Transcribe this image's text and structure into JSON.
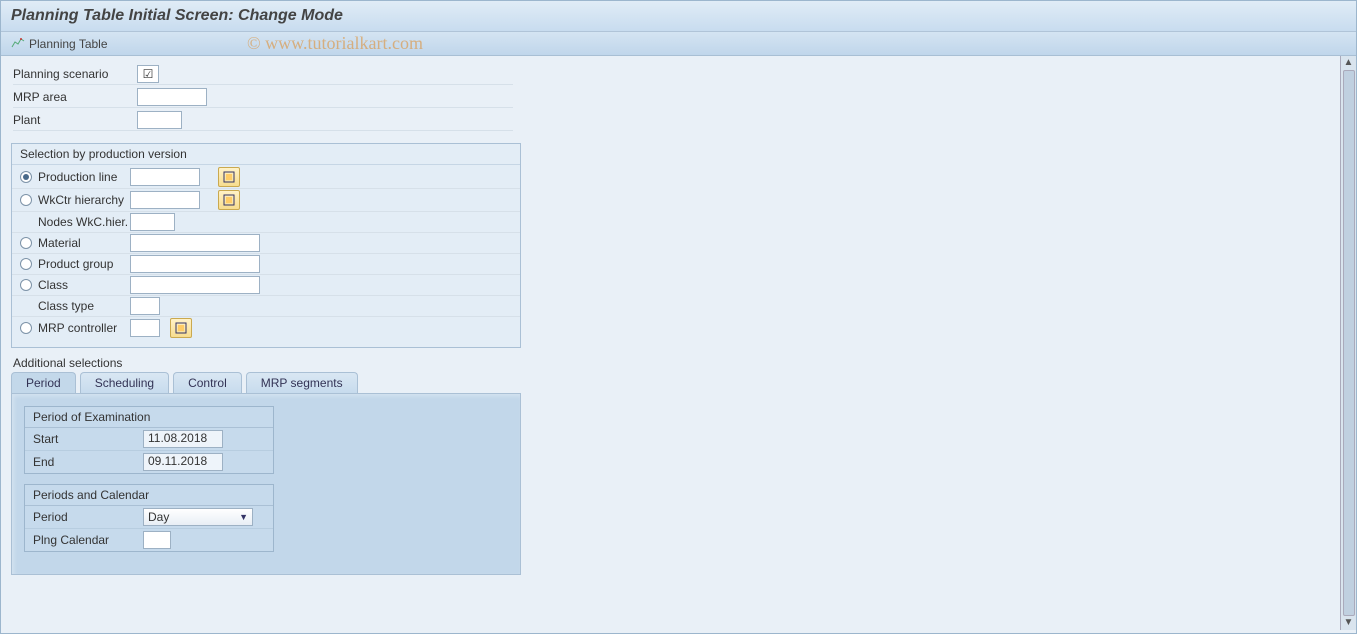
{
  "title": "Planning Table Initial Screen: Change Mode",
  "toolbar": {
    "planning_table": "Planning Table"
  },
  "watermark": "© www.tutorialkart.com",
  "top": {
    "planning_scenario_label": "Planning scenario",
    "planning_scenario_checked": "☑",
    "mrp_area_label": "MRP area",
    "plant_label": "Plant"
  },
  "pv": {
    "title": "Selection by production version",
    "rows": {
      "production_line": "Production line",
      "wkctr_hierarchy": "WkCtr hierarchy",
      "nodes_wkc": "Nodes WkC.hier.",
      "material": "Material",
      "product_group": "Product group",
      "class": "Class",
      "class_type": "Class type",
      "mrp_controller": "MRP controller"
    }
  },
  "add_sel": {
    "title": "Additional selections",
    "tabs": {
      "period": "Period",
      "scheduling": "Scheduling",
      "control": "Control",
      "mrp_segments": "MRP segments"
    }
  },
  "period_box": {
    "title": "Period of Examination",
    "start_label": "Start",
    "start_value": "11.08.2018",
    "end_label": "End",
    "end_value": "09.11.2018"
  },
  "cal_box": {
    "title": "Periods and Calendar",
    "period_label": "Period",
    "period_value": "Day",
    "plng_cal_label": "Plng Calendar"
  }
}
